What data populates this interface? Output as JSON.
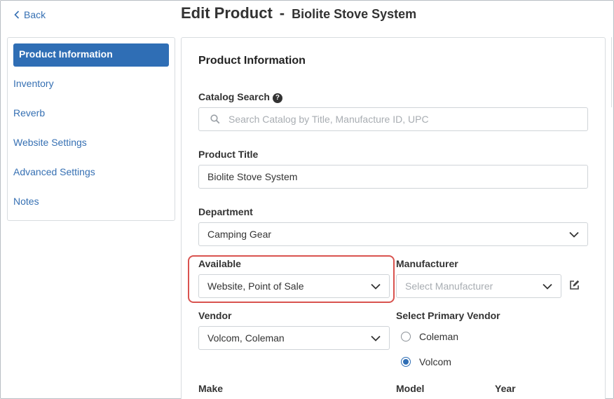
{
  "header": {
    "back_label": "Back",
    "title": "Edit Product",
    "separator": "-",
    "product_name": "Biolite Stove System"
  },
  "sidebar": {
    "items": [
      {
        "label": "Product Information",
        "active": true
      },
      {
        "label": "Inventory"
      },
      {
        "label": "Reverb"
      },
      {
        "label": "Website Settings"
      },
      {
        "label": "Advanced Settings"
      },
      {
        "label": "Notes"
      }
    ]
  },
  "form": {
    "section_title": "Product Information",
    "catalog_search": {
      "label": "Catalog Search",
      "placeholder": "Search Catalog by Title, Manufacture ID, UPC"
    },
    "product_title": {
      "label": "Product Title",
      "value": "Biolite Stove System"
    },
    "department": {
      "label": "Department",
      "value": "Camping Gear"
    },
    "available": {
      "label": "Available",
      "value": "Website, Point of Sale"
    },
    "manufacturer": {
      "label": "Manufacturer",
      "placeholder": "Select Manufacturer"
    },
    "vendor": {
      "label": "Vendor",
      "value": "Volcom, Coleman"
    },
    "primary_vendor": {
      "label": "Select Primary Vendor",
      "options": [
        {
          "label": "Coleman",
          "selected": false
        },
        {
          "label": "Volcom",
          "selected": true
        }
      ]
    },
    "make": {
      "label": "Make"
    },
    "model": {
      "label": "Model"
    },
    "year": {
      "label": "Year"
    }
  },
  "colors": {
    "accent": "#2f6eb5",
    "link": "#3670b3",
    "highlight": "#d9534f"
  },
  "icons": [
    "chevron-left-icon",
    "help-icon",
    "search-icon",
    "chevron-down-icon",
    "edit-icon"
  ]
}
